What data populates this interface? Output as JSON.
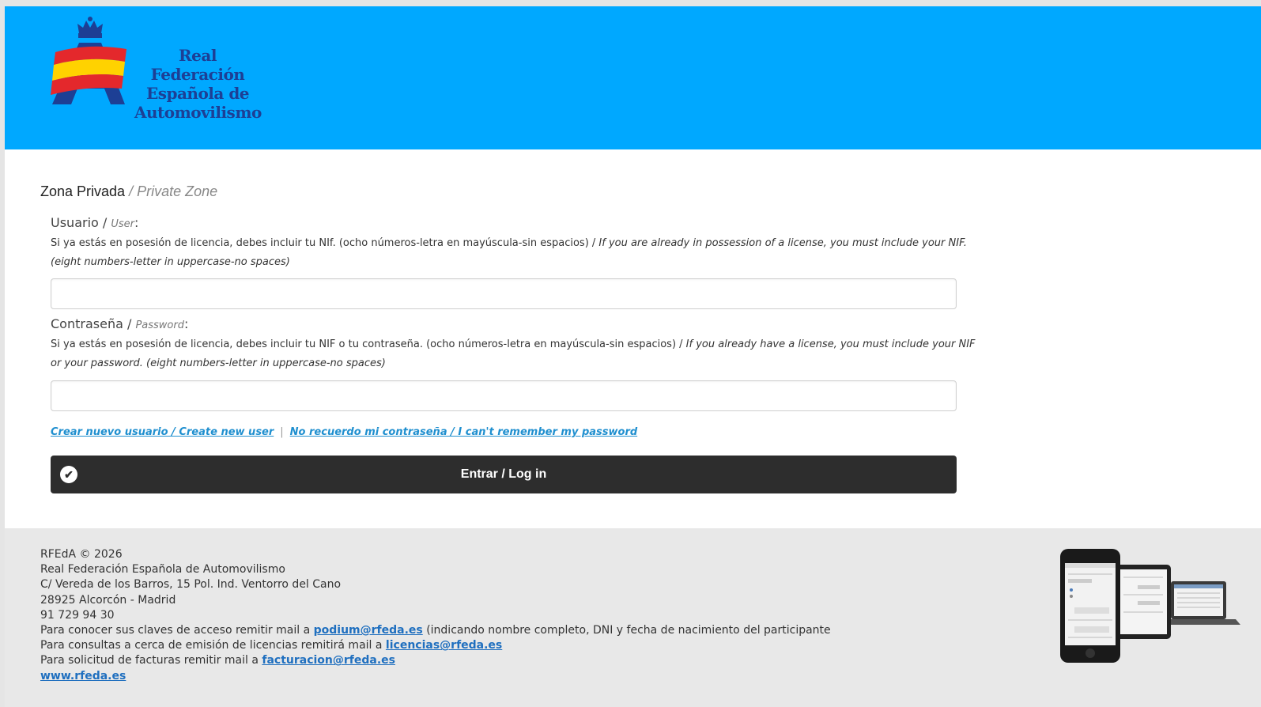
{
  "header": {
    "logo_lines": [
      "Real Federación",
      "Española de",
      "Automovilismo"
    ],
    "background_color": "#00a8ff"
  },
  "form": {
    "title_es": "Zona Privada",
    "title_sep": " / ",
    "title_en": "Private Zone",
    "user": {
      "label_es": "Usuario / ",
      "label_en": "User",
      "label_colon": ":",
      "help_es": "Si ya estás en posesión de licencia, debes incluir tu NIf. (ocho números-letra en mayúscula-sin espacios) / ",
      "help_en": "If you are already in possession of a license, you must include your NIF. (eight numbers-letter in uppercase-no spaces)",
      "value": ""
    },
    "password": {
      "label_es": "Contraseña / ",
      "label_en": "Password",
      "label_colon": ":",
      "help_es": "Si ya estás en posesión de licencia, debes incluir tu NIF o tu contraseña. (ocho números-letra en mayúscula-sin espacios) / ",
      "help_en": "If you already have a license, you must include your NIF or your password. (eight numbers-letter in uppercase-no spaces)",
      "value": ""
    },
    "links": {
      "create_user": "Crear nuevo usuario / Create new user",
      "separator": "|",
      "forgot_password": "No recuerdo mi contraseña / I can't remember my password"
    },
    "login_button": "Entrar / Log in"
  },
  "footer": {
    "copyright": "RFEdA © 2026",
    "org_name": "Real Federación Española de Automovilismo",
    "address": "C/ Vereda de los Barros, 15 Pol. Ind. Ventorro del Cano",
    "city": "28925 Alcorcón - Madrid",
    "phone": "91 729 94 30",
    "access_prefix": "Para conocer sus claves de acceso remitir mail a ",
    "access_email": "podium@rfeda.es",
    "access_suffix": " (indicando nombre completo, DNI y fecha de nacimiento del participante",
    "licenses_prefix": "Para consultas a cerca de emisión de licencias remitirá mail a ",
    "licenses_email": "licencias@rfeda.es",
    "invoices_prefix": "Para solicitud de facturas remitir mail a ",
    "invoices_email": "facturacion@rfeda.es",
    "website": "www.rfeda.es"
  }
}
